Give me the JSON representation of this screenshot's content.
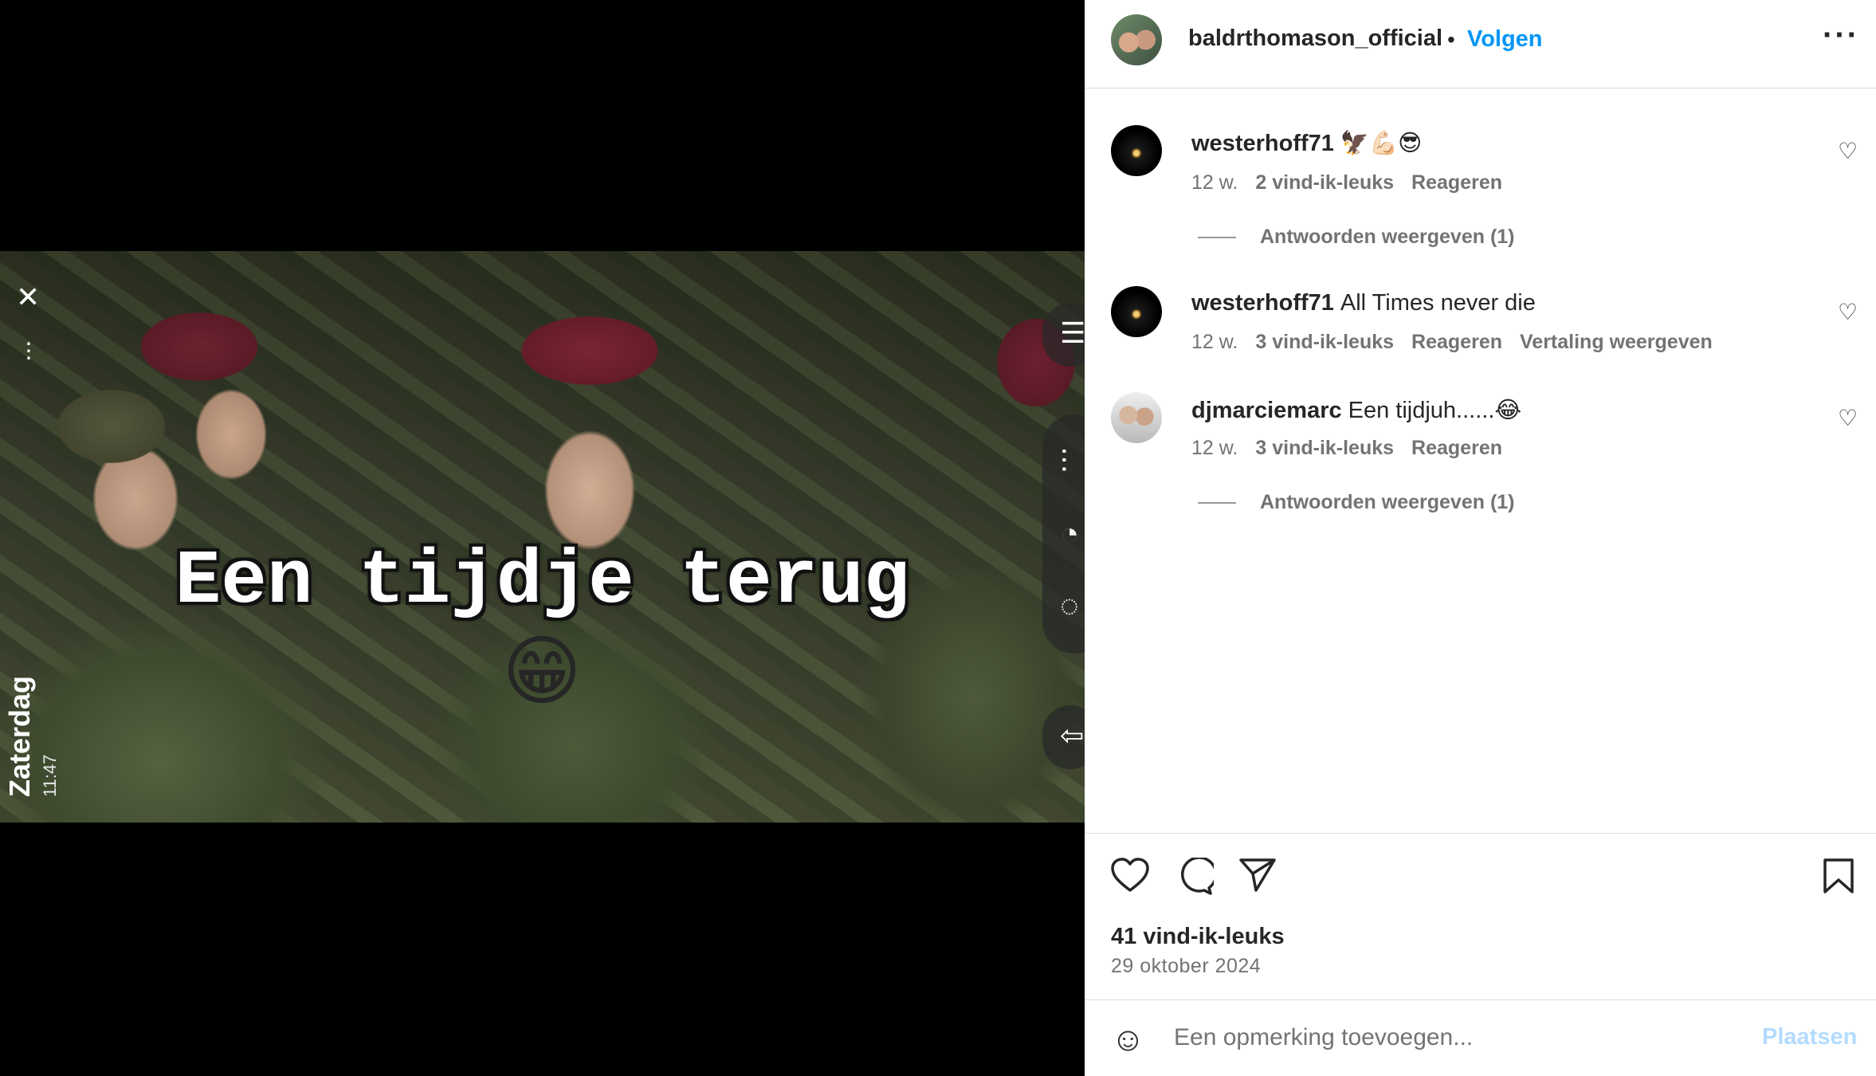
{
  "story": {
    "caption": "Een tijdje terug",
    "caption_emoji": "😁",
    "day": "Zaterdag",
    "time": "11:47"
  },
  "header": {
    "username": "baldrthomason_official",
    "separator": "•",
    "follow_label": "Volgen",
    "more_icon": "more-horizontal-icon",
    "accent_color": "#0095f6"
  },
  "comments": [
    {
      "username": "westerhoff71",
      "text": "🦅💪🏻😎",
      "age": "12 w.",
      "likes": "2 vind-ik-leuks",
      "reply": "Reageren",
      "view_replies": "Antwoorden weergeven (1)"
    },
    {
      "username": "westerhoff71",
      "text": "All Times never die",
      "age": "12 w.",
      "likes": "3 vind-ik-leuks",
      "reply": "Reageren",
      "translate": "Vertaling weergeven"
    },
    {
      "username": "djmarciemarc",
      "text": "Een tijdjuh......😂",
      "age": "12 w.",
      "likes": "3 vind-ik-leuks",
      "reply": "Reageren",
      "view_replies": "Antwoorden weergeven (1)"
    }
  ],
  "post": {
    "likes": "41 vind-ik-leuks",
    "date": "29 oktober 2024"
  },
  "composer": {
    "placeholder": "Een opmerking toevoegen...",
    "post_label": "Plaatsen"
  }
}
